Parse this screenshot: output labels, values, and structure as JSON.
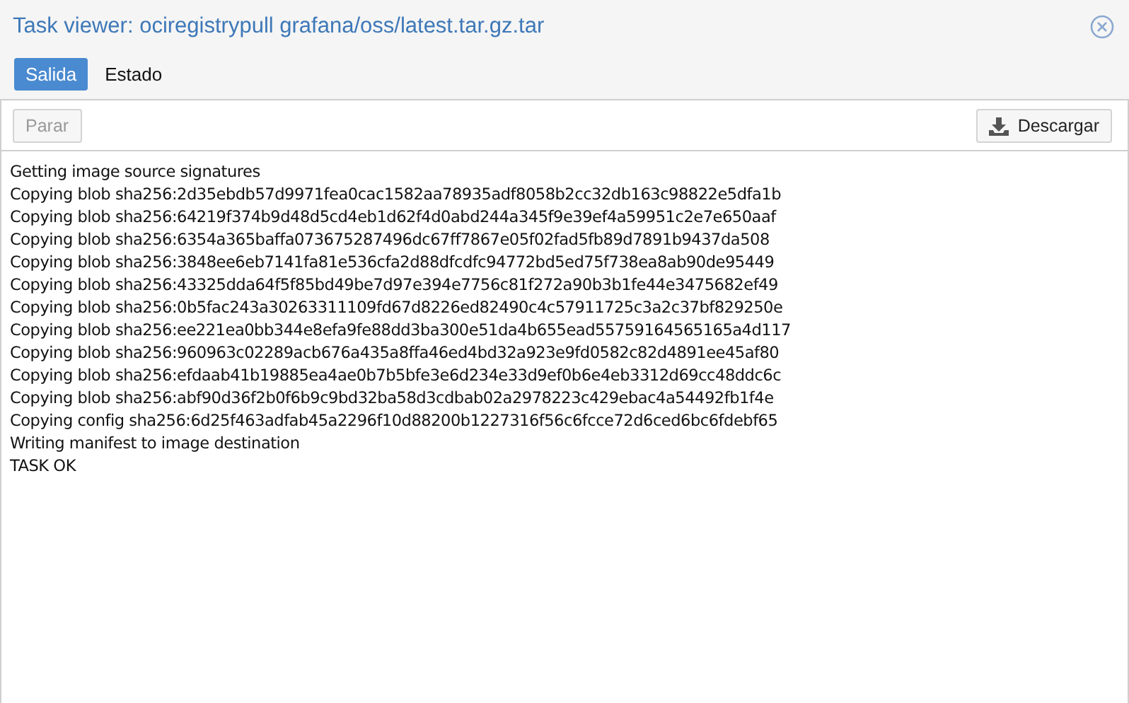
{
  "window": {
    "title": "Task viewer: ociregistrypull grafana/oss/latest.tar.gz.tar"
  },
  "tabs": [
    {
      "label": "Salida",
      "selected": true
    },
    {
      "label": "Estado",
      "selected": false
    }
  ],
  "toolbar": {
    "stop_button": {
      "label": "Parar",
      "disabled": true
    },
    "download_button": {
      "label": "Descargar",
      "disabled": false
    }
  },
  "log_lines": [
    "Getting image source signatures",
    "Copying blob sha256:2d35ebdb57d9971fea0cac1582aa78935adf8058b2cc32db163c98822e5dfa1b",
    "Copying blob sha256:64219f374b9d48d5cd4eb1d62f4d0abd244a345f9e39ef4a59951c2e7e650aaf",
    "Copying blob sha256:6354a365baffa073675287496dc67ff7867e05f02fad5fb89d7891b9437da508",
    "Copying blob sha256:3848ee6eb7141fa81e536cfa2d88dfcdfc94772bd5ed75f738ea8ab90de95449",
    "Copying blob sha256:43325dda64f5f85bd49be7d97e394e7756c81f272a90b3b1fe44e3475682ef49",
    "Copying blob sha256:0b5fac243a30263311109fd67d8226ed82490c4c57911725c3a2c37bf829250e",
    "Copying blob sha256:ee221ea0bb344e8efa9fe88dd3ba300e51da4b655ead55759164565165a4d117",
    "Copying blob sha256:960963c02289acb676a435a8ffa46ed4bd32a923e9fd0582c82d4891ee45af80",
    "Copying blob sha256:efdaab41b19885ea4ae0b7b5bfe3e6d234e33d9ef0b6e4eb3312d69cc48ddc6c",
    "Copying blob sha256:abf90d36f2b0f6b9c9bd32ba58d3cdbab02a2978223c429ebac4a54492fb1f4e",
    "Copying config sha256:6d25f463adfab45a2296f10d88200b1227316f56c6fcce72d6ced6bc6fdebf65",
    "Writing manifest to image destination",
    "TASK OK"
  ]
}
